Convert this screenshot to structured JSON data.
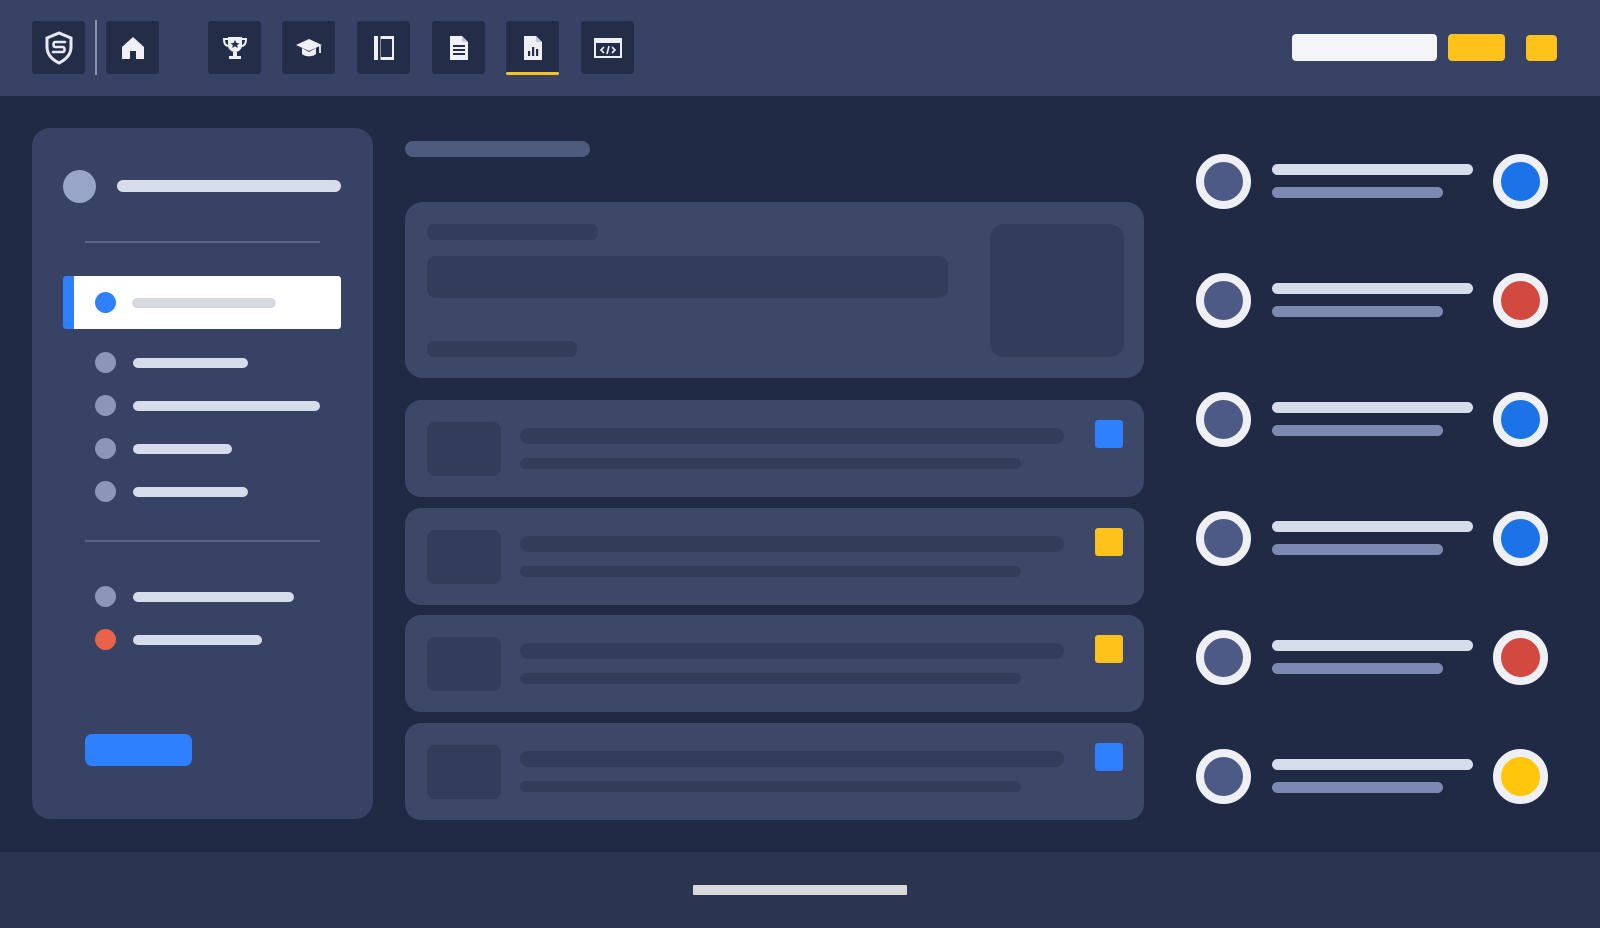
{
  "topbar": {
    "nav_icons": [
      "shield-logo-icon",
      "home-icon",
      "trophy-icon",
      "graduation-cap-icon",
      "notebook-icon",
      "document-icon",
      "report-chart-icon",
      "code-window-icon"
    ],
    "active_nav": "report-chart-icon"
  },
  "sidebar": {
    "active_item_index": 0,
    "item_dot_colors": [
      "#2f80ff",
      "#8b96b8",
      "#8b96b8",
      "#8b96b8",
      "#8b96b8",
      "#8b96b8",
      "#e8634a"
    ]
  },
  "main": {
    "card_tag_colors": [
      "#2f80ff",
      "#ffc21a",
      "#ffc21a",
      "#2f80ff"
    ]
  },
  "right_list": {
    "status_colors": [
      "#1c73e8",
      "#d24a3f",
      "#1c73e8",
      "#1c73e8",
      "#d24a3f",
      "#ffc60a"
    ]
  },
  "colors": {
    "accent_blue": "#2f80ff",
    "accent_yellow": "#ffc21a",
    "accent_red": "#e8634a",
    "background": "#202a44",
    "topbar": "#374265"
  }
}
